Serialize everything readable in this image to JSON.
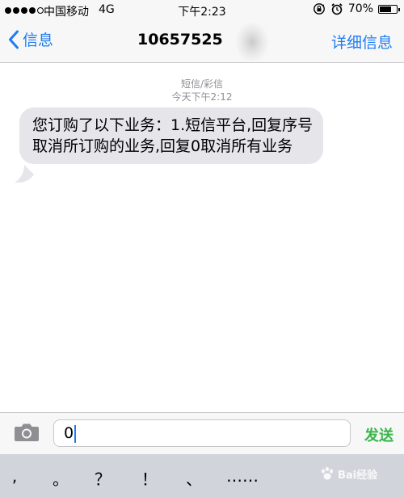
{
  "status_bar": {
    "carrier": "中国移动",
    "network": "4G",
    "time": "下午2:23",
    "battery_text": "70%",
    "battery_level": 0.7
  },
  "nav": {
    "back_label": "信息",
    "title": "10657525",
    "details_label": "详细信息"
  },
  "message": {
    "type_label": "短信/彩信",
    "timestamp": "今天下午2:12",
    "body": "您订购了以下业务：1.短信平台,回复序号取消所订购的业务,回复0取消所有业务"
  },
  "input": {
    "value": "0",
    "send_label": "发送"
  },
  "keyboard": {
    "keys": [
      ",",
      "。",
      "？",
      "！",
      "、",
      "……"
    ]
  },
  "watermark": {
    "text": "Bai经验"
  },
  "colors": {
    "accent": "#1e7cf2",
    "send": "#39b54a",
    "bubble": "#e5e5ea",
    "meta": "#8e8e93"
  }
}
